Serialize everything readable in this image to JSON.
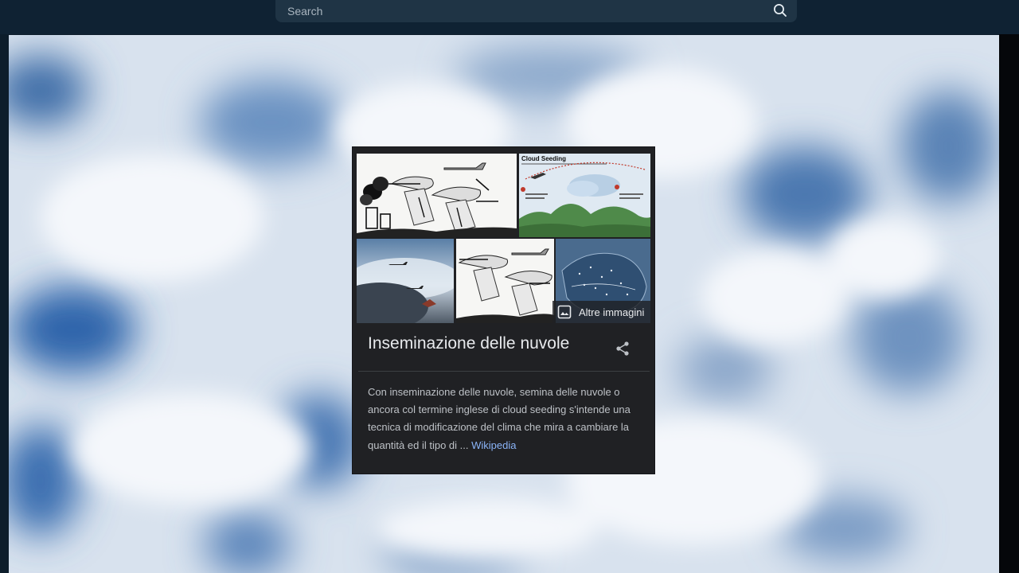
{
  "search": {
    "placeholder": "Search",
    "value": ""
  },
  "knowledge_card": {
    "more_images_label": "Altre immagini",
    "title": "Inseminazione delle nuvole",
    "description": "Con inseminazione delle nuvole, semina delle nuvole o ancora col termine inglese di cloud seeding s'intende una tecnica di modificazione del clima che mira a cambiare la quantità ed il tipo di ...",
    "source_link": "Wikipedia",
    "thumbnails": [
      {
        "name": "cloud-seeding-diagram-sketch"
      },
      {
        "name": "cloud-seeding-infographic",
        "heading": "Cloud Seeding"
      },
      {
        "name": "storm-cloud-airplane-photo"
      },
      {
        "name": "cloud-seeding-sketch-2"
      },
      {
        "name": "cloud-seeding-map"
      }
    ]
  },
  "colors": {
    "topbar": "#0f2233",
    "search_bg": "#1f3445",
    "card_bg": "#202124",
    "link": "#8ab4f8",
    "sky_blue": "#5f86b8"
  },
  "icons": [
    "search-icon",
    "image-icon",
    "share-icon"
  ]
}
